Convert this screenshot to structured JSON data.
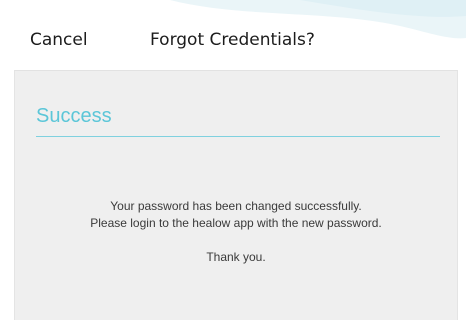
{
  "header": {
    "cancel_label": "Cancel",
    "title": "Forgot Credentials?"
  },
  "card": {
    "heading": "Success",
    "message_line1": "Your password has been changed successfully.",
    "message_line2": "Please login to the healow app with the new password.",
    "thanks": "Thank you."
  },
  "colors": {
    "accent": "#5bc6d8",
    "divider": "#7fd1df",
    "card_background": "#efefef",
    "text": "#3a3a3a",
    "header_decor": "#e6f4f8"
  }
}
